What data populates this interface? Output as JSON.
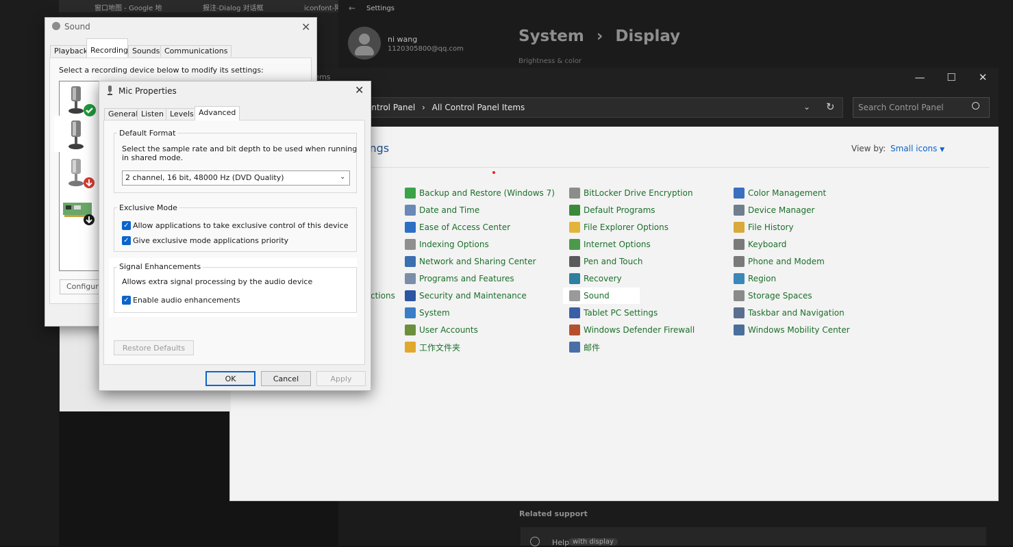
{
  "browser": {
    "tabs": [
      "窗口地图 - Google 地",
      "报注-Dialog 对话框",
      "iconfont-阿里"
    ]
  },
  "settings": {
    "window_label": "Settings",
    "user_name": "ni wang",
    "user_email": "1120305800@qq.com",
    "breadcrumb_root": "System",
    "breadcrumb_sep": "›",
    "breadcrumb_page": "Display",
    "section_label": "Brightness & color",
    "related_support": "Related support",
    "help_text": "Help",
    "help_link": "with display"
  },
  "control_panel": {
    "fragment_title_top": "tems",
    "address_root": "ontrol Panel",
    "address_sep": "›",
    "address_page": "All Control Panel Items",
    "search_placeholder": "Search Control Panel",
    "heading": "ings",
    "view_by_label": "View by:",
    "view_by_value": "Small icons",
    "left_fragment": "ctions",
    "columns": [
      {
        "items": [
          {
            "label": "Backup and Restore (Windows 7)",
            "icon": "backup-icon",
            "color": "#3aa34a"
          },
          {
            "label": "Date and Time",
            "icon": "clock-icon",
            "color": "#6a88b8"
          },
          {
            "label": "Ease of Access Center",
            "icon": "ease-of-access-icon",
            "color": "#2d6fc4"
          },
          {
            "label": "Indexing Options",
            "icon": "indexing-icon",
            "color": "#8f8f8f"
          },
          {
            "label": "Network and Sharing Center",
            "icon": "network-icon",
            "color": "#3b6fb0"
          },
          {
            "label": "Programs and Features",
            "icon": "programs-icon",
            "color": "#7a8ea8"
          },
          {
            "label": "Security and Maintenance",
            "icon": "flag-icon",
            "color": "#2c55a3"
          },
          {
            "label": "System",
            "icon": "system-icon",
            "color": "#3a7ec7"
          },
          {
            "label": "User Accounts",
            "icon": "users-icon",
            "color": "#6b8f3e"
          },
          {
            "label": "工作文件夹",
            "icon": "work-folders-icon",
            "color": "#e0a92e"
          }
        ]
      },
      {
        "items": [
          {
            "label": "BitLocker Drive Encryption",
            "icon": "bitlocker-icon",
            "color": "#8c8c8c"
          },
          {
            "label": "Default Programs",
            "icon": "default-programs-icon",
            "color": "#3a8a3a"
          },
          {
            "label": "File Explorer Options",
            "icon": "folder-options-icon",
            "color": "#e3b43a"
          },
          {
            "label": "Internet Options",
            "icon": "internet-icon",
            "color": "#4a9a4a"
          },
          {
            "label": "Pen and Touch",
            "icon": "pen-icon",
            "color": "#5a5a5a"
          },
          {
            "label": "Recovery",
            "icon": "recovery-icon",
            "color": "#2f7f9f"
          },
          {
            "label": "Sound",
            "icon": "speaker-icon",
            "color": "#9a9a9a"
          },
          {
            "label": "Tablet PC Settings",
            "icon": "tablet-icon",
            "color": "#3a5fa8"
          },
          {
            "label": "Windows Defender Firewall",
            "icon": "firewall-icon",
            "color": "#b5502e"
          },
          {
            "label": "邮件",
            "icon": "mail-icon",
            "color": "#4a6fa8"
          }
        ]
      },
      {
        "items": [
          {
            "label": "Color Management",
            "icon": "color-management-icon",
            "color": "#3a6fbf"
          },
          {
            "label": "Device Manager",
            "icon": "device-manager-icon",
            "color": "#6f7f8f"
          },
          {
            "label": "File History",
            "icon": "file-history-icon",
            "color": "#d9a93a"
          },
          {
            "label": "Keyboard",
            "icon": "keyboard-icon",
            "color": "#7a7a7a"
          },
          {
            "label": "Phone and Modem",
            "icon": "phone-icon",
            "color": "#7a7a7a"
          },
          {
            "label": "Region",
            "icon": "globe-icon",
            "color": "#3a88b8"
          },
          {
            "label": "Storage Spaces",
            "icon": "storage-icon",
            "color": "#8a8a8a"
          },
          {
            "label": "Taskbar and Navigation",
            "icon": "taskbar-icon",
            "color": "#5a6f8f"
          },
          {
            "label": "Windows Mobility Center",
            "icon": "mobility-icon",
            "color": "#4a6f9a"
          }
        ]
      }
    ]
  },
  "sound_dialog": {
    "title": "Sound",
    "tabs": [
      "Playback",
      "Recording",
      "Sounds",
      "Communications"
    ],
    "active_tab": "Recording",
    "instruction": "Select a recording device below to modify its settings:",
    "configure_button": "Configure"
  },
  "mic_properties": {
    "title": "Mic Properties",
    "tabs": [
      "General",
      "Listen",
      "Levels",
      "Advanced"
    ],
    "active_tab": "Advanced",
    "default_format": {
      "group_title": "Default Format",
      "description_line1": "Select the sample rate and bit depth to be used when running",
      "description_line2": "in shared mode.",
      "selected_value": "2 channel, 16 bit, 48000 Hz (DVD Quality)"
    },
    "exclusive_mode": {
      "group_title": "Exclusive Mode",
      "option1": "Allow applications to take exclusive control of this device",
      "option2": "Give exclusive mode applications priority"
    },
    "signal_enhancements": {
      "group_title": "Signal Enhancements",
      "description": "Allows extra signal processing by the audio device",
      "option": "Enable audio enhancements"
    },
    "restore_defaults": "Restore Defaults",
    "ok": "OK",
    "cancel": "Cancel",
    "apply": "Apply",
    "checkmark": "✓"
  }
}
